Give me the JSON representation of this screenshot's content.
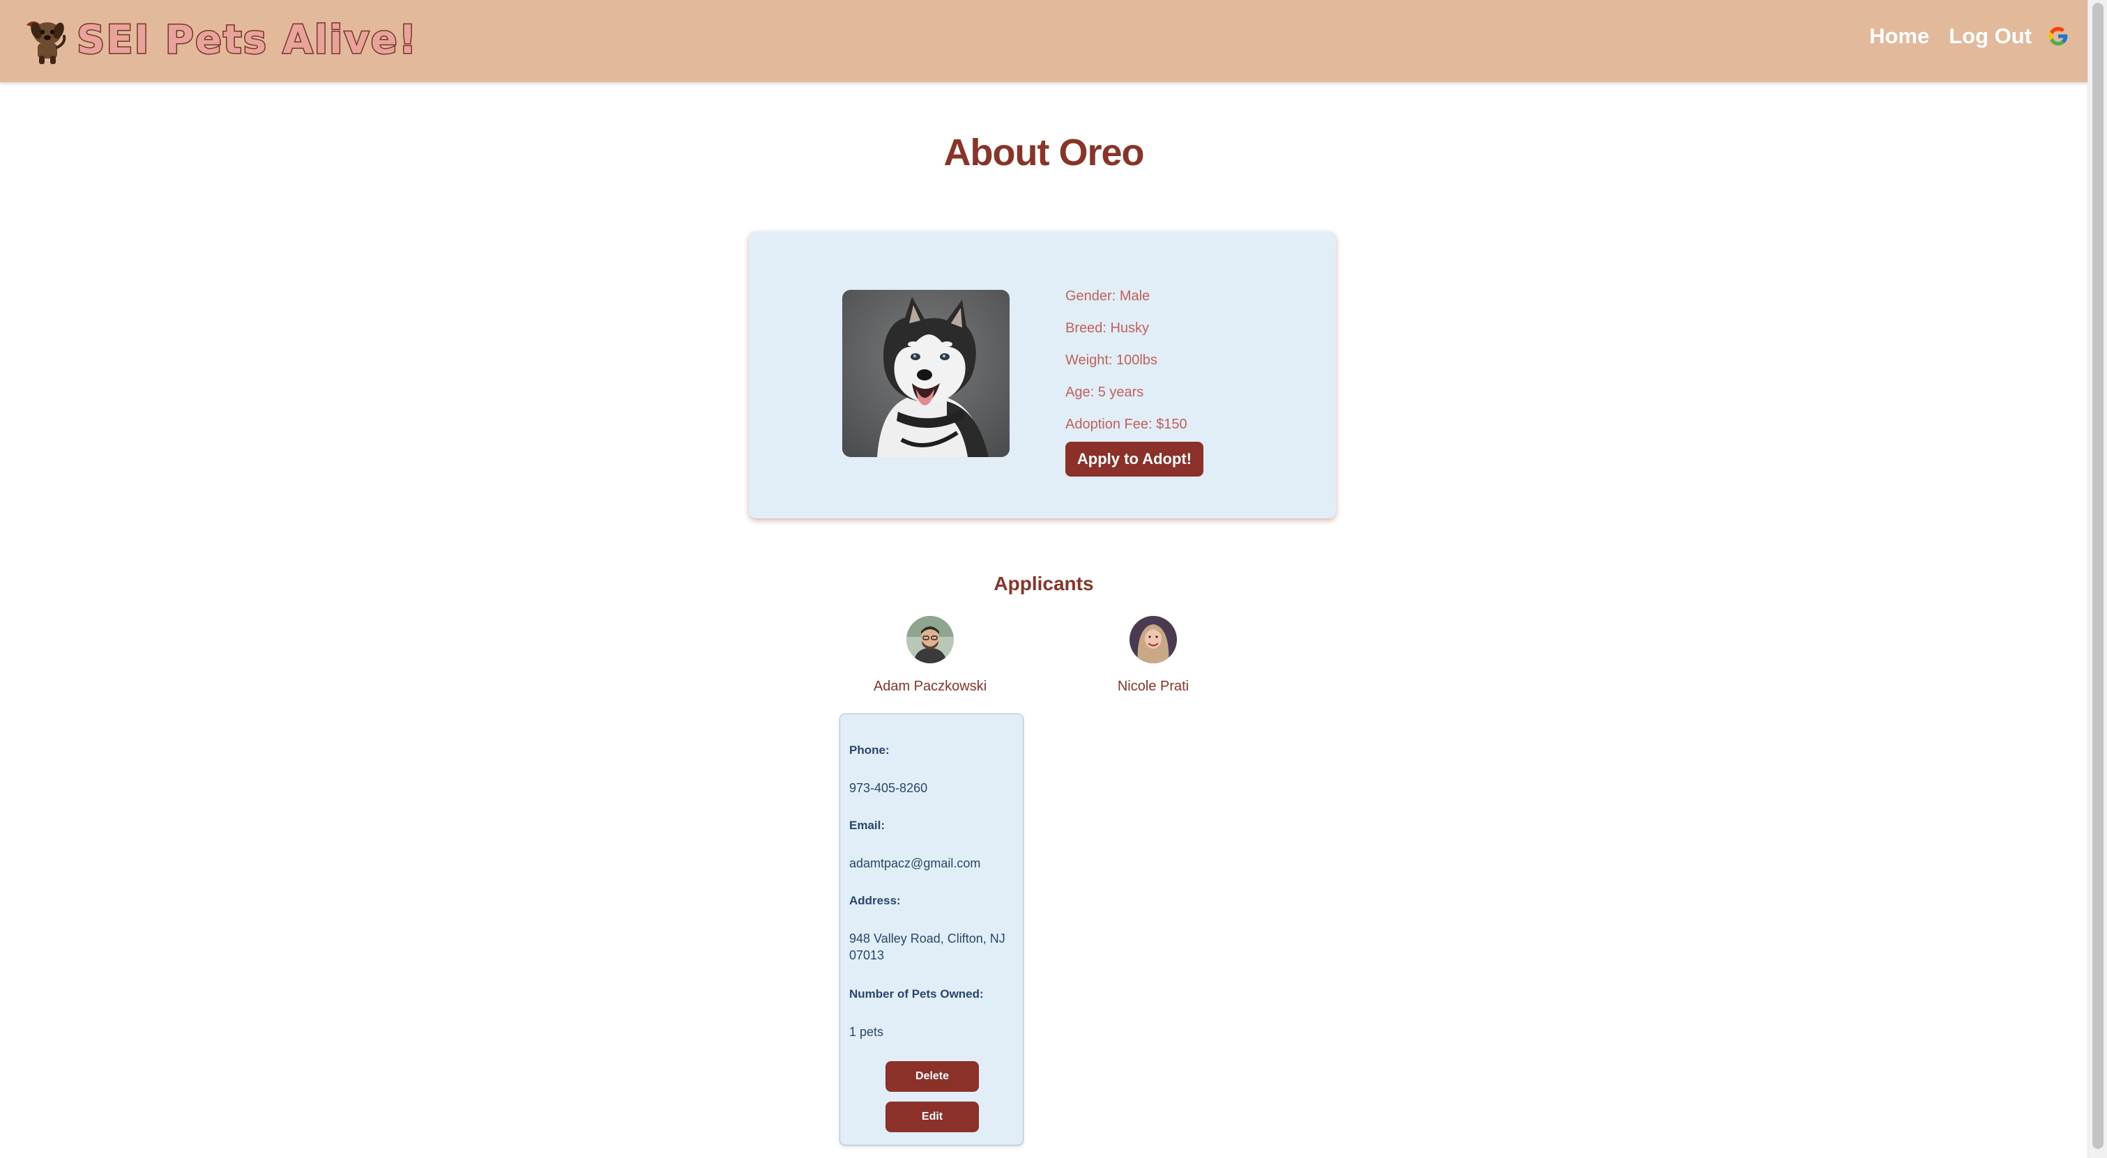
{
  "navbar": {
    "brand_title": "SEI Pets Alive!",
    "logo_icon": "dog-logo-icon",
    "links": [
      {
        "label": "Home"
      },
      {
        "label": "Log Out"
      }
    ],
    "account_icon": "google-icon",
    "background_color": "#e2b99b"
  },
  "page": {
    "title": "About Oreo"
  },
  "pet": {
    "photo": "husky-photo",
    "gender": "Gender: Male",
    "breed": "Breed: Husky",
    "weight": "Weight: 100lbs",
    "age": "Age: 5 years",
    "adoption_fee": "Adoption Fee: $150",
    "apply_label": "Apply to Adopt!"
  },
  "applicants": {
    "heading": "Applicants",
    "list": [
      {
        "name": "Adam Paczkowski",
        "avatar": "applicant-avatar"
      },
      {
        "name": "Nicole Prati",
        "avatar": "applicant-avatar"
      }
    ],
    "selected": {
      "phone_label": "Phone:",
      "phone": "973-405-8260",
      "email_label": "Email:",
      "email": "adamtpacz@gmail.com",
      "address_label": "Address:",
      "address": "948 Valley Road, Clifton, NJ 07013",
      "pets_label": "Number of Pets Owned:",
      "pets": "1 pets",
      "delete_label": "Delete",
      "edit_label": "Edit"
    }
  },
  "colors": {
    "accent": "#8b3129",
    "card_background": "#e2eef7",
    "detail_text": "#28466b"
  }
}
